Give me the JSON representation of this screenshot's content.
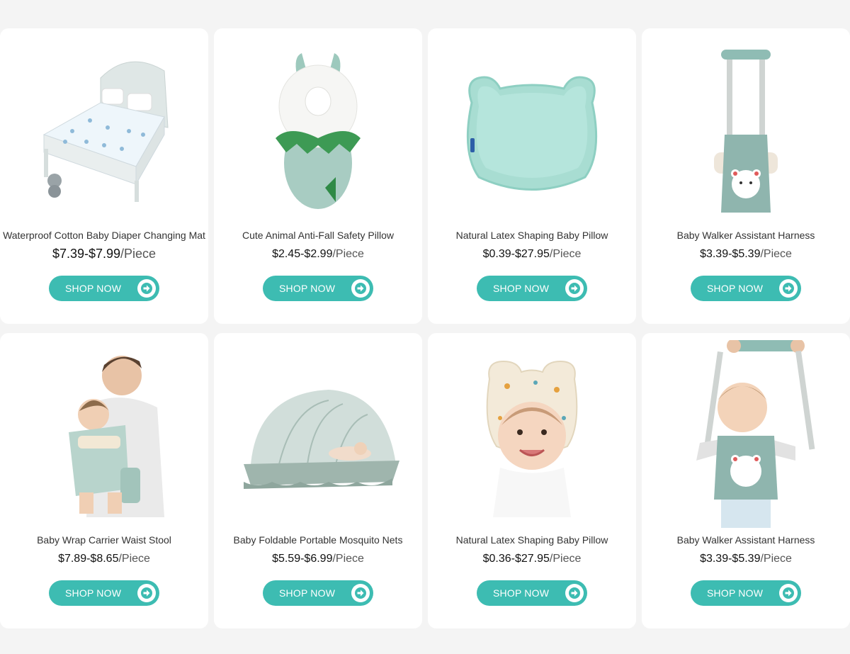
{
  "products": [
    {
      "name": "Waterproof Cotton Baby Diaper Changing Mat",
      "price": "$7.39-$7.99",
      "unit": "/Piece",
      "image": "bed-mat-image",
      "button": "SHOP NOW",
      "icon": "arrow-right-icon"
    },
    {
      "name": "Cute Animal Anti-Fall Safety Pillow",
      "price": "$2.45-$2.99",
      "unit": "/Piece",
      "image": "dino-pillow-image",
      "button": "SHOP NOW",
      "icon": "arrow-right-icon"
    },
    {
      "name": "Natural Latex Shaping Baby Pillow",
      "price": "$0.39-$27.95",
      "unit": "/Piece",
      "image": "latex-pillow-image",
      "button": "SHOP NOW",
      "icon": "arrow-right-icon"
    },
    {
      "name": "Baby Walker  Assistant Harness",
      "price": "$3.39-$5.39",
      "unit": "/Piece",
      "image": "walker-harness-image",
      "button": "SHOP NOW",
      "icon": "arrow-right-icon"
    },
    {
      "name": "Baby Wrap Carrier Waist Stool",
      "price": "$7.89-$8.65",
      "unit": "/Piece",
      "image": "baby-carrier-image",
      "button": "SHOP NOW",
      "icon": "arrow-right-icon"
    },
    {
      "name": "Baby Foldable Portable Mosquito Nets",
      "price": "$5.59-$6.99",
      "unit": "/Piece",
      "image": "mosquito-net-image",
      "button": "SHOP NOW",
      "icon": "arrow-right-icon"
    },
    {
      "name": "Natural Latex Shaping Baby Pillow",
      "price": "$0.36-$27.95",
      "unit": "/Piece",
      "image": "baby-pillow-image",
      "button": "SHOP NOW",
      "icon": "arrow-right-icon"
    },
    {
      "name": "Baby Walker  Assistant Harness",
      "price": "$3.39-$5.39",
      "unit": "/Piece",
      "image": "walker-baby-image",
      "button": "SHOP NOW",
      "icon": "arrow-right-icon"
    }
  ],
  "colors": {
    "accent": "#3dbcb2",
    "background": "#f4f4f4",
    "card": "#ffffff",
    "product_mint": "#a8ddd2"
  }
}
